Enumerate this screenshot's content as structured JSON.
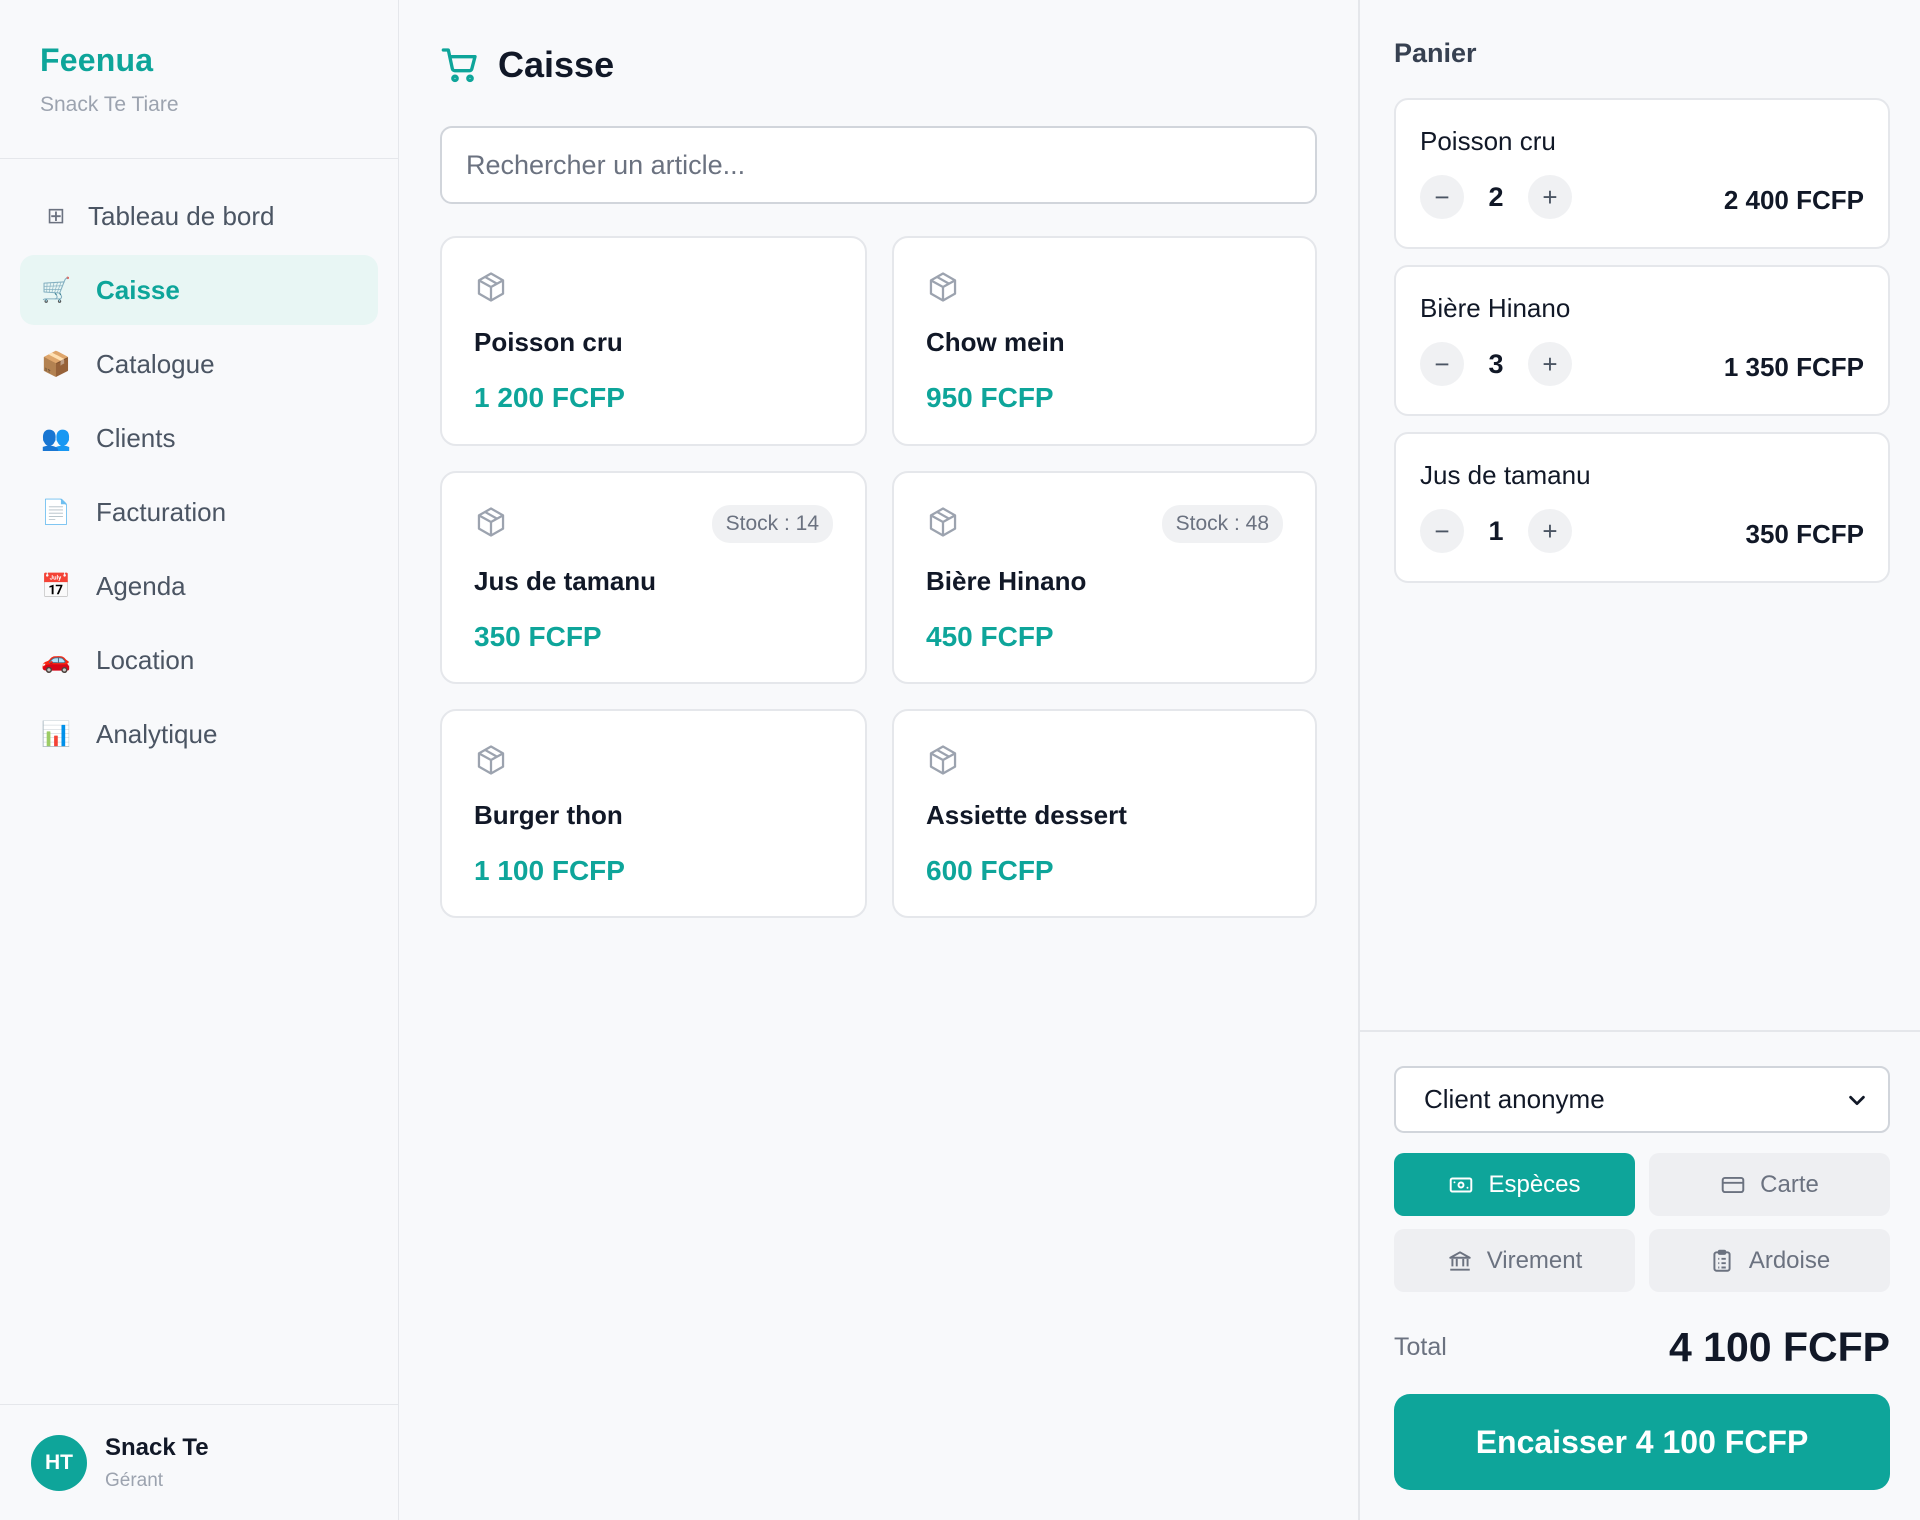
{
  "brand": {
    "name": "Feenua",
    "subtitle": "Snack Te Tiare"
  },
  "nav": [
    {
      "label": "Tableau de bord",
      "icon": "⊞",
      "icon_name": "dashboard-grid-icon"
    },
    {
      "label": "Caisse",
      "icon": "🛒",
      "icon_name": "cart-icon"
    },
    {
      "label": "Catalogue",
      "icon": "📦",
      "icon_name": "package-icon"
    },
    {
      "label": "Clients",
      "icon": "👥",
      "icon_name": "users-icon"
    },
    {
      "label": "Facturation",
      "icon": "📄",
      "icon_name": "document-icon"
    },
    {
      "label": "Agenda",
      "icon": "📅",
      "icon_name": "calendar-icon"
    },
    {
      "label": "Location",
      "icon": "🚗",
      "icon_name": "car-icon"
    },
    {
      "label": "Analytique",
      "icon": "📊",
      "icon_name": "chart-icon"
    }
  ],
  "active_nav": "Caisse",
  "user": {
    "initials": "HT",
    "name": "Snack Te",
    "role": "Gérant"
  },
  "page": {
    "title": "Caisse",
    "title_icon": "cart-icon"
  },
  "search": {
    "placeholder": "Rechercher un article...",
    "value": ""
  },
  "products": [
    {
      "name": "Poisson cru",
      "price": "1 200 FCFP",
      "stock": ""
    },
    {
      "name": "Chow mein",
      "price": "950 FCFP",
      "stock": ""
    },
    {
      "name": "Jus de tamanu",
      "price": "350 FCFP",
      "stock": "Stock : 14"
    },
    {
      "name": "Bière Hinano",
      "price": "450 FCFP",
      "stock": "Stock : 48"
    },
    {
      "name": "Burger thon",
      "price": "1 100 FCFP",
      "stock": ""
    },
    {
      "name": "Assiette dessert",
      "price": "600 FCFP",
      "stock": ""
    }
  ],
  "cart": {
    "title": "Panier",
    "items": [
      {
        "name": "Poisson cru",
        "qty": "2",
        "price": "2 400 FCFP"
      },
      {
        "name": "Bière Hinano",
        "qty": "3",
        "price": "1 350 FCFP"
      },
      {
        "name": "Jus de tamanu",
        "qty": "1",
        "price": "350 FCFP"
      }
    ],
    "minus": "−",
    "plus": "+"
  },
  "checkout": {
    "client": "Client anonyme",
    "payment_methods": [
      {
        "label": "Espèces",
        "icon": "cash-icon",
        "active": true
      },
      {
        "label": "Carte",
        "icon": "card-icon",
        "active": false
      },
      {
        "label": "Virement",
        "icon": "bank-icon",
        "active": false
      },
      {
        "label": "Ardoise",
        "icon": "clipboard-icon",
        "active": false
      }
    ],
    "total_label": "Total",
    "total_value": "4 100 FCFP",
    "cta": "Encaisser 4 100 FCFP"
  },
  "colors": {
    "accent": "#0ea59a",
    "accent_soft": "#e8f6f4",
    "border": "#e5e7eb",
    "muted": "#6b7280"
  }
}
